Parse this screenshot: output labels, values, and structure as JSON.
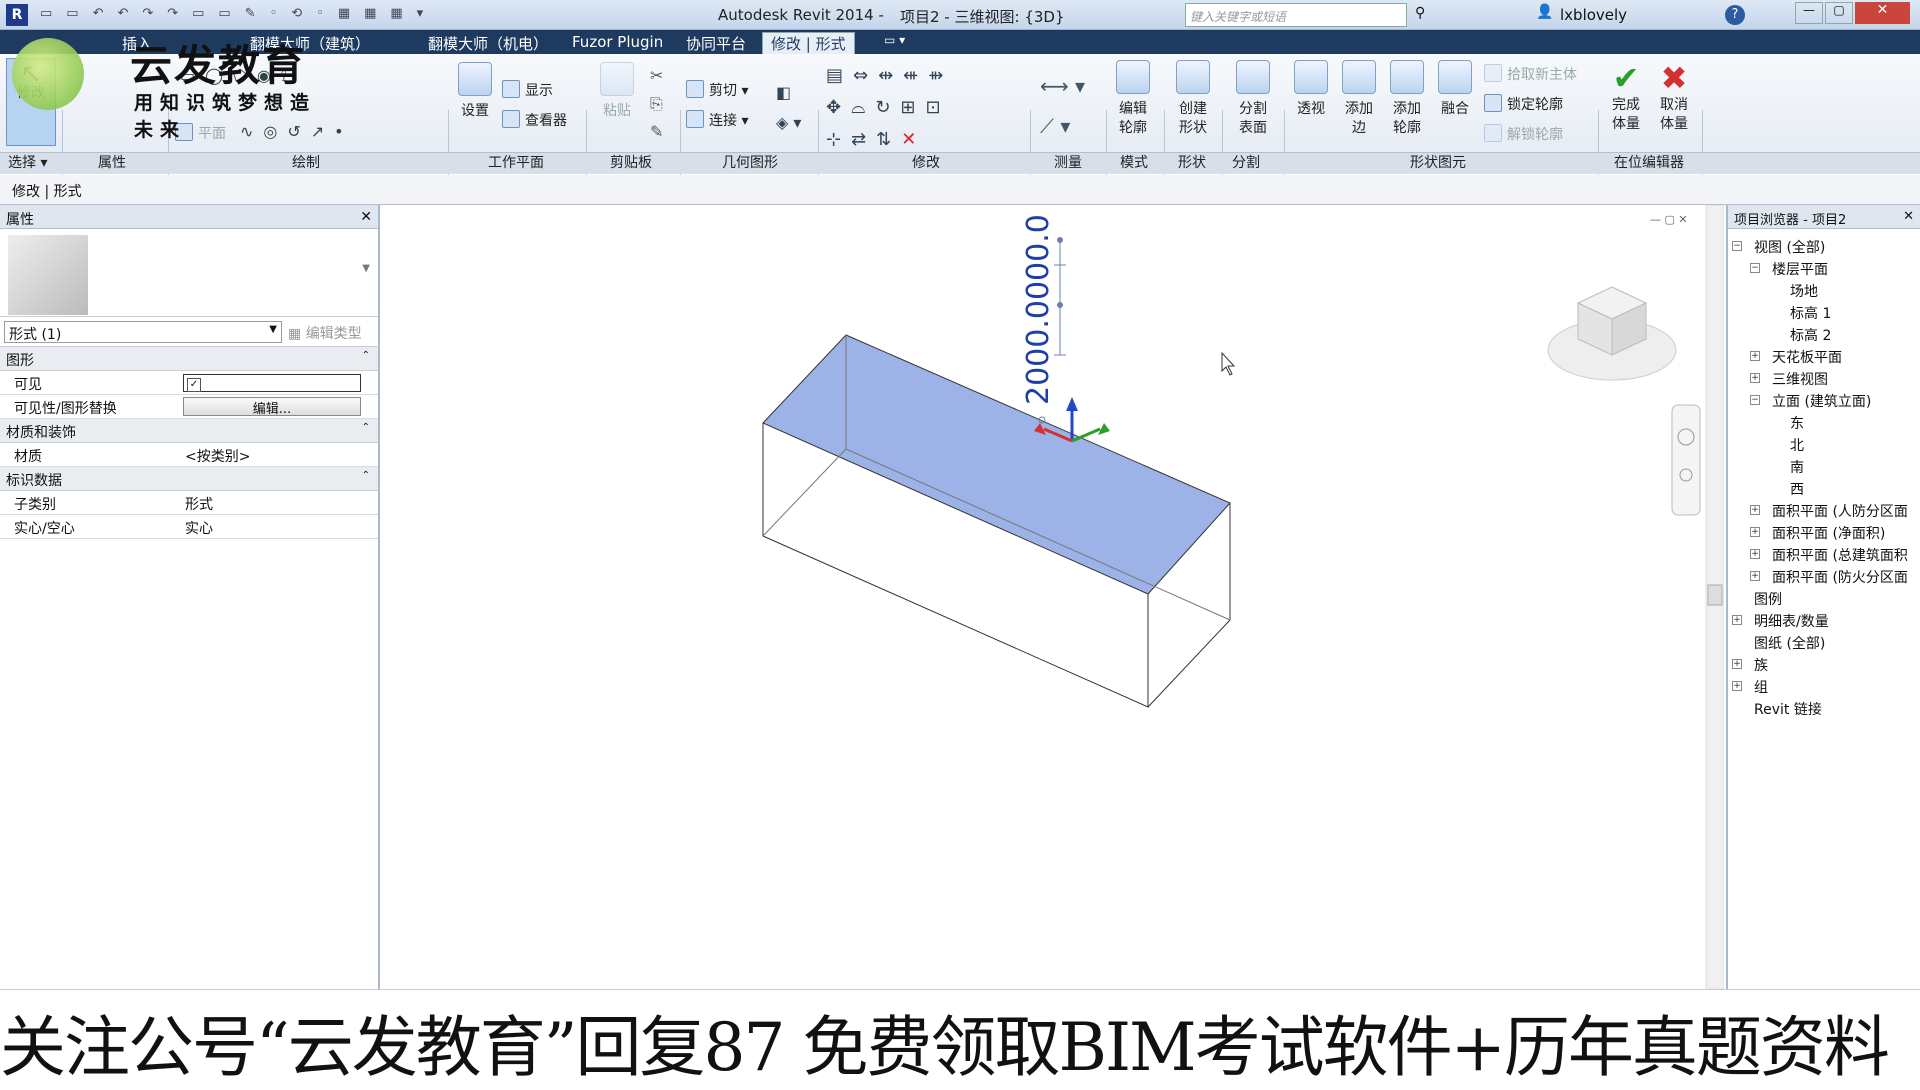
{
  "app": {
    "title": "Autodesk Revit 2014 -",
    "doc_title": "项目2 - 三维视图: {3D}",
    "search_placeholder": "键入关键字或短语",
    "user": "lxblovely"
  },
  "logo": {
    "name": "云发教育",
    "slogan": "用知识筑梦想造未来"
  },
  "tabs": [
    {
      "label": "插入"
    },
    {
      "label": "翻模大师（建筑）"
    },
    {
      "label": "翻模大师（机电）"
    },
    {
      "label": "Fuzor Plugin"
    },
    {
      "label": "协同平台"
    },
    {
      "label": "修改 | 形式"
    }
  ],
  "ribbon": {
    "modify": "修改",
    "set": "设置",
    "show": "显示",
    "viewer": "查看器",
    "paste": "粘贴",
    "cut": "剪切",
    "join": "连接",
    "plane": "平面",
    "edit_profile": [
      "编辑",
      "轮廓"
    ],
    "create_form": [
      "创建",
      "形状"
    ],
    "divide_surface": [
      "分割",
      "表面"
    ],
    "xray": "透视",
    "add_edge": [
      "添加",
      "边"
    ],
    "add_profile": [
      "添加",
      "轮廓"
    ],
    "dissolve": "融合",
    "pick_host": "拾取新主体",
    "lock_profile": "锁定轮廓",
    "unlock_profile": "解锁轮廓",
    "finish_mass": [
      "完成",
      "体量"
    ],
    "cancel_mass": [
      "取消",
      "体量"
    ]
  },
  "groups": {
    "select": "选择 ▾",
    "properties": "属性",
    "draw": "绘制",
    "workplane": "工作平面",
    "clipboard": "剪贴板",
    "geometry": "几何图形",
    "modify": "修改",
    "measure": "测量",
    "mode": "模式",
    "form": "形状",
    "divide": "分割",
    "form_element": "形状图元",
    "inplace": "在位编辑器"
  },
  "context_bar": "修改 | 形式",
  "properties": {
    "title": "属性",
    "type_selector": "形式 (1)",
    "edit_type": "编辑类型",
    "sections": [
      {
        "name": "图形",
        "rows": [
          {
            "key": "可见",
            "value": "✓"
          },
          {
            "key": "可见性/图形替换",
            "value": "编辑..."
          }
        ]
      },
      {
        "name": "材质和装饰",
        "rows": [
          {
            "key": "材质",
            "value": "<按类别>"
          }
        ]
      },
      {
        "name": "标识数据",
        "rows": [
          {
            "key": "子类别",
            "value": "形式"
          },
          {
            "key": "实心/空心",
            "value": "实心"
          }
        ]
      }
    ]
  },
  "viewport": {
    "dimension": "2000.0000.0"
  },
  "browser": {
    "title": "项目浏览器 - 项目2",
    "items": [
      {
        "label": "视图 (全部)",
        "level": 0,
        "toggle": "−"
      },
      {
        "label": "楼层平面",
        "level": 1,
        "toggle": "−"
      },
      {
        "label": "场地",
        "level": 2
      },
      {
        "label": "标高 1",
        "level": 2
      },
      {
        "label": "标高 2",
        "level": 2
      },
      {
        "label": "天花板平面",
        "level": 1,
        "toggle": "+"
      },
      {
        "label": "三维视图",
        "level": 1,
        "toggle": "+"
      },
      {
        "label": "立面 (建筑立面)",
        "level": 1,
        "toggle": "−"
      },
      {
        "label": "东",
        "level": 2
      },
      {
        "label": "北",
        "level": 2
      },
      {
        "label": "南",
        "level": 2
      },
      {
        "label": "西",
        "level": 2
      },
      {
        "label": "面积平面 (人防分区面",
        "level": 1,
        "toggle": "+"
      },
      {
        "label": "面积平面 (净面积)",
        "level": 1,
        "toggle": "+"
      },
      {
        "label": "面积平面 (总建筑面积",
        "level": 1,
        "toggle": "+"
      },
      {
        "label": "面积平面 (防火分区面",
        "level": 1,
        "toggle": "+"
      },
      {
        "label": "图例",
        "level": 0
      },
      {
        "label": "明细表/数量",
        "level": 0,
        "toggle": "+"
      },
      {
        "label": "图纸 (全部)",
        "level": 0
      },
      {
        "label": "族",
        "level": 0,
        "toggle": "+"
      },
      {
        "label": "组",
        "level": 0,
        "toggle": "+"
      },
      {
        "label": "Revit 链接",
        "level": 0
      }
    ]
  },
  "banner": "关注公号“云发教育”回复87 免费领取BIM考试软件+历年真题资料",
  "colors": {
    "accent": "#1f3a5f",
    "face": "#9db3e8",
    "tab_active": "#e8eef6"
  }
}
